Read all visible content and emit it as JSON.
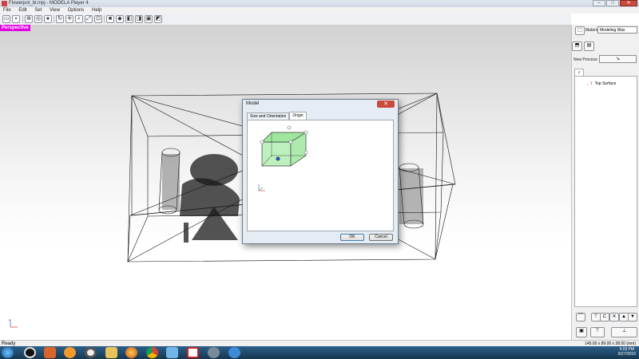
{
  "window": {
    "title": "Flowerpot_bl.mpj - MODELA Player 4",
    "buttons": {
      "minimize": "–",
      "maximize": "□",
      "close": "✕"
    }
  },
  "menu": [
    "File",
    "Edit",
    "Set",
    "View",
    "Options",
    "Help"
  ],
  "toolbar": {
    "icons": [
      "open-file-icon",
      "save-icon",
      "zoom-extents-icon",
      "rotate-view-icon",
      "pan-view-icon",
      "zoom-view-icon",
      "fit-view-icon",
      "front-view-icon",
      "top-view-icon",
      "side-view-icon",
      "iso-view-icon",
      "box-view-icon",
      "bottom-view-icon"
    ]
  },
  "viewport": {
    "label": "Perspective",
    "label_color": "#e100e1"
  },
  "right_panel": {
    "material_label": "Material",
    "material_value": "Modeling Wax",
    "new_process_label": "New Process:",
    "tree_item": "Top Surface"
  },
  "status": {
    "ready": "Ready",
    "dimensions": "145.00 x 89.00 x 38.00 (mm)"
  },
  "dialog": {
    "title": "Model",
    "tabs": [
      "Size and Orientation",
      "Origin"
    ],
    "active_tab": "Origin",
    "ok_label": "OK",
    "cancel_label": "Cancel",
    "close_label": "✕"
  },
  "taskbar": {
    "icons": [
      "start-button",
      "media-player-icon",
      "app-icon",
      "vlc-icon",
      "chrome-icon",
      "file-explorer-icon",
      "firefox-icon",
      "chrome-icon",
      "paint-icon",
      "modela-icon",
      "settings-icon",
      "ie-icon"
    ],
    "time": "5:03 PM",
    "date": "6/27/2016"
  }
}
